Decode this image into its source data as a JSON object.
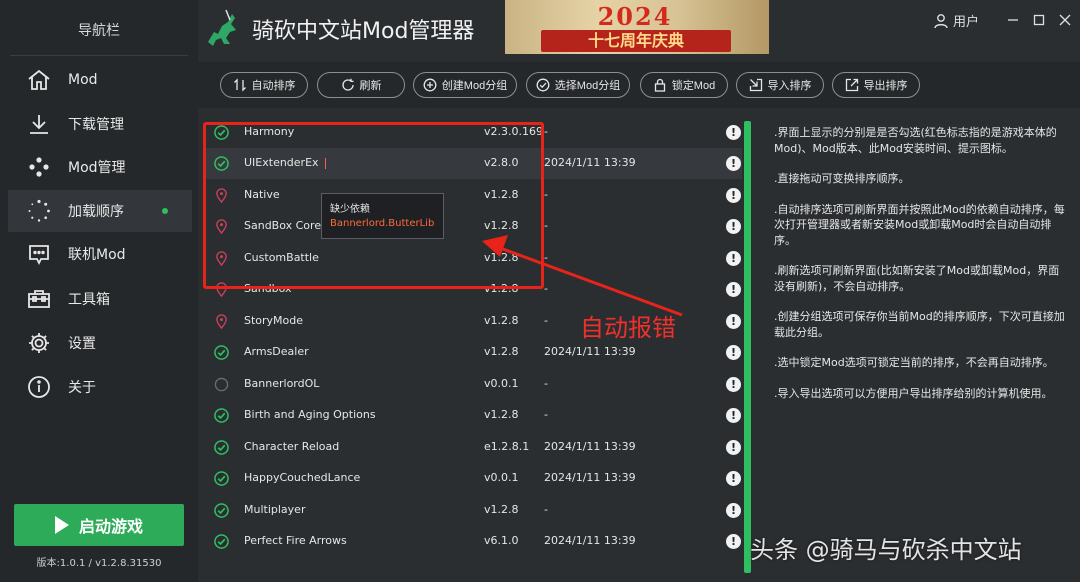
{
  "sidebar": {
    "title": "导航栏",
    "items": [
      {
        "label": "Mod",
        "icon": "home-icon"
      },
      {
        "label": "下载管理",
        "icon": "download-icon"
      },
      {
        "label": "Mod管理",
        "icon": "dots-icon"
      },
      {
        "label": "加载顺序",
        "icon": "loading-icon",
        "active": true
      },
      {
        "label": "联机Mod",
        "icon": "chat-icon"
      },
      {
        "label": "工具箱",
        "icon": "toolbox-icon"
      },
      {
        "label": "设置",
        "icon": "gear-icon"
      },
      {
        "label": "关于",
        "icon": "info-icon"
      }
    ],
    "launch_label": "启动游戏",
    "version": "版本:1.0.1 / v1.2.8.31530"
  },
  "header": {
    "title": "骑砍中文站Mod管理器",
    "banner_year": "2024",
    "banner_text": "十七周年庆典",
    "user_label": "用户"
  },
  "toolbar": {
    "buttons": [
      {
        "label": "自动排序",
        "icon": "sort-icon"
      },
      {
        "label": "刷新",
        "icon": "refresh-icon"
      },
      {
        "label": "创建Mod分组",
        "icon": "plus-circle-icon"
      },
      {
        "label": "选择Mod分组",
        "icon": "check-circle-icon"
      },
      {
        "label": "锁定Mod",
        "icon": "lock-icon"
      },
      {
        "label": "导入排序",
        "icon": "import-icon"
      },
      {
        "label": "导出排序",
        "icon": "export-icon"
      }
    ]
  },
  "mods": [
    {
      "name": "Harmony",
      "version": "v2.3.0.169",
      "date": "-",
      "status": "ok"
    },
    {
      "name": "UIExtenderEx",
      "version": "v2.8.0",
      "date": "2024/1/11 13:39",
      "status": "ok"
    },
    {
      "name": "Native",
      "version": "v1.2.8",
      "date": "-",
      "status": "official"
    },
    {
      "name": "SandBox Core",
      "version": "v1.2.8",
      "date": "-",
      "status": "official"
    },
    {
      "name": "CustomBattle",
      "version": "v1.2.8",
      "date": "-",
      "status": "official"
    },
    {
      "name": "Sandbox",
      "version": "v1.2.8",
      "date": "-",
      "status": "official"
    },
    {
      "name": "StoryMode",
      "version": "v1.2.8",
      "date": "-",
      "status": "official"
    },
    {
      "name": "ArmsDealer",
      "version": "v1.2.8",
      "date": "2024/1/11 13:39",
      "status": "ok"
    },
    {
      "name": "BannerlordOL",
      "version": "v0.0.1",
      "date": "-",
      "status": "off"
    },
    {
      "name": "Birth and Aging Options",
      "version": "v1.2.8",
      "date": "-",
      "status": "ok"
    },
    {
      "name": "Character Reload",
      "version": "e1.2.8.1",
      "date": "2024/1/11 13:39",
      "status": "ok"
    },
    {
      "name": "HappyCouchedLance",
      "version": "v0.0.1",
      "date": "2024/1/11 13:39",
      "status": "ok"
    },
    {
      "name": "Multiplayer",
      "version": "v1.2.8",
      "date": "-",
      "status": "ok"
    },
    {
      "name": "Perfect Fire Arrows",
      "version": "v6.1.0",
      "date": "2024/1/11 13:39",
      "status": "ok"
    }
  ],
  "tooltip": {
    "title": "缺少依赖",
    "detail": "Bannerlord.ButterLib"
  },
  "annotation": "自动报错",
  "help": [
    ".界面上显示的分别是是否勾选(红色标志指的是游戏本体的Mod)、Mod版本、此Mod安装时间、提示图标。",
    ".直接拖动可变换排序顺序。",
    ".自动排序选项可刷新界面并按照此Mod的依赖自动排序，每次打开管理器或者新安装Mod或卸载Mod时会自动自动排序。",
    ".刷新选项可刷新界面(比如新安装了Mod或卸载Mod，界面没有刷新)，不会自动排序。",
    ".创建分组选项可保存你当前Mod的排序顺序，下次可直接加载此分组。",
    ".选中锁定Mod选项可锁定当前的排序，不会再自动排序。",
    ".导入导出选项可以方便用户导出排序给别的计算机使用。"
  ],
  "watermark": "头条 @骑马与砍杀中文站",
  "colors": {
    "accent": "#2fbf61",
    "official": "#c8405a",
    "annotation": "#e8231a"
  }
}
